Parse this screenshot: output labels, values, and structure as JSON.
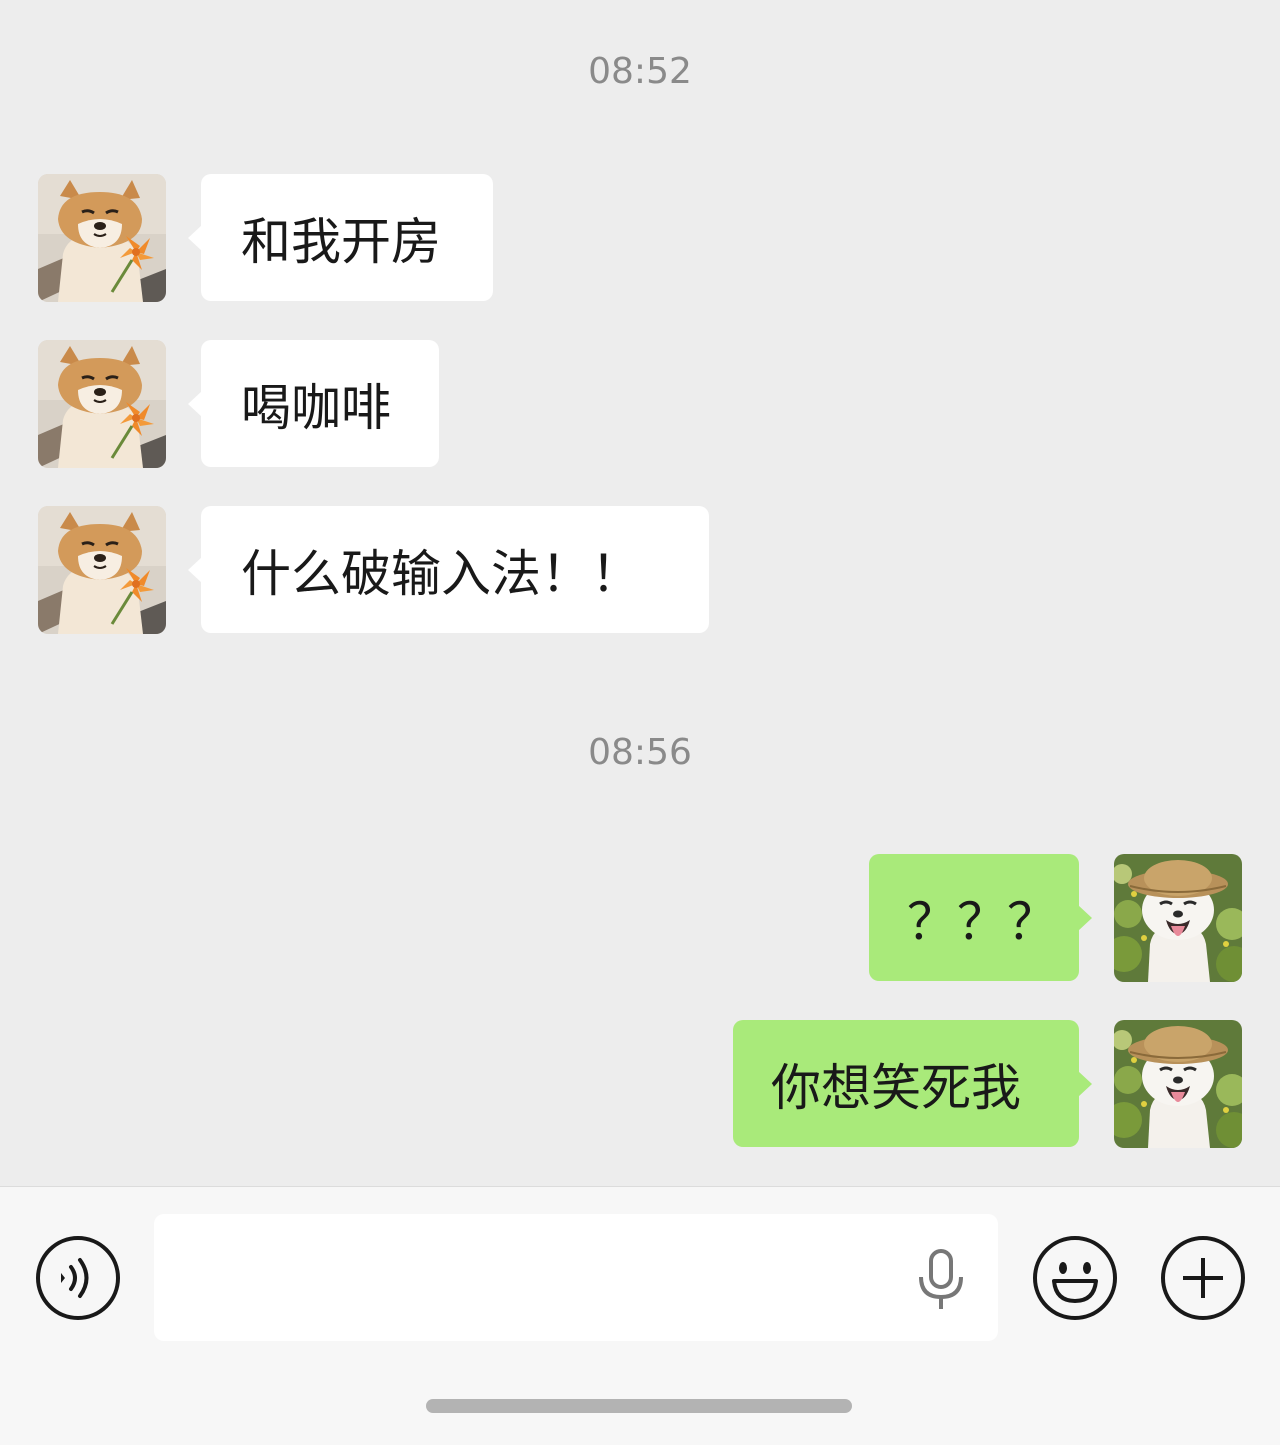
{
  "chat": {
    "timestamps": [
      "08:52",
      "08:56"
    ],
    "messages": [
      {
        "sender": "other",
        "text": "和我开房"
      },
      {
        "sender": "other",
        "text": "喝咖啡"
      },
      {
        "sender": "other",
        "text": "什么破输入法！！"
      },
      {
        "sender": "self",
        "text": "？？？"
      },
      {
        "sender": "self",
        "text": "你想笑死我"
      }
    ]
  },
  "avatars": {
    "other": "shiba-dog-with-flower-avatar",
    "self": "white-dog-straw-hat-avatar"
  },
  "input_bar": {
    "voice_toggle_icon": "voice-icon",
    "mic_icon": "microphone-icon",
    "emoji_icon": "emoji-icon",
    "more_icon": "plus-icon",
    "input_value": ""
  },
  "colors": {
    "chat_background": "#ededed",
    "incoming_bubble": "#ffffff",
    "outgoing_bubble": "#a9ea7a",
    "input_bar_background": "#f7f7f7",
    "timestamp_text": "#8a8a8a"
  }
}
